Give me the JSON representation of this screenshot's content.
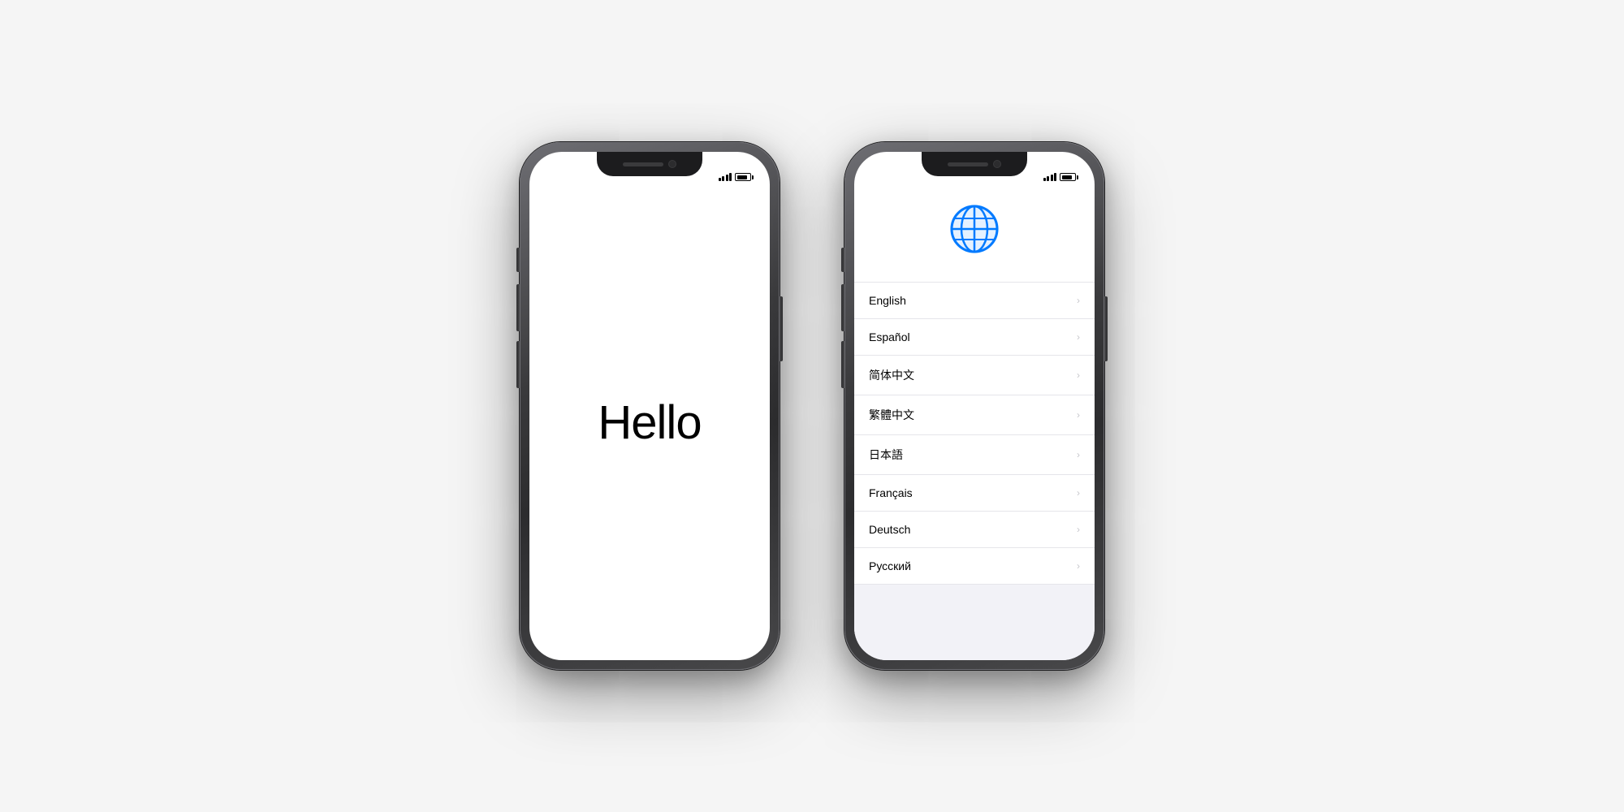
{
  "page": {
    "background": "#f5f5f5"
  },
  "phone_hello": {
    "hello_text": "Hello",
    "status": {
      "signal_label": "signal",
      "battery_label": "battery"
    }
  },
  "phone_language": {
    "globe_icon": "globe-icon",
    "languages": [
      {
        "id": "english",
        "label": "English"
      },
      {
        "id": "espanol",
        "label": "Español"
      },
      {
        "id": "simplified-chinese",
        "label": "简体中文"
      },
      {
        "id": "traditional-chinese",
        "label": "繁體中文"
      },
      {
        "id": "japanese",
        "label": "日本語"
      },
      {
        "id": "french",
        "label": "Français"
      },
      {
        "id": "german",
        "label": "Deutsch"
      },
      {
        "id": "russian",
        "label": "Русский"
      }
    ]
  }
}
